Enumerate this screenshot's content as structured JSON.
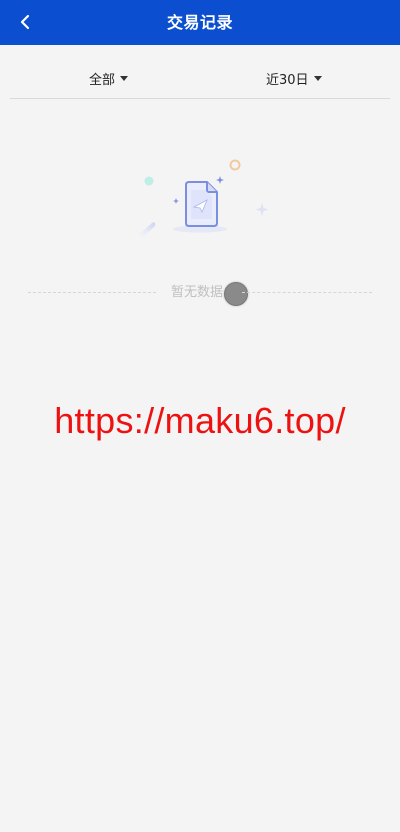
{
  "header": {
    "title": "交易记录",
    "back_icon": "chevron-left-icon",
    "bg_color": "#0b4fd0"
  },
  "filters": {
    "type_label": "全部",
    "range_label": "近30日"
  },
  "empty_state": {
    "text": "暂无数据",
    "illustration_icon": "empty-document-icon"
  },
  "watermark": {
    "text": "https://maku6.top/",
    "color": "#ee1111"
  }
}
